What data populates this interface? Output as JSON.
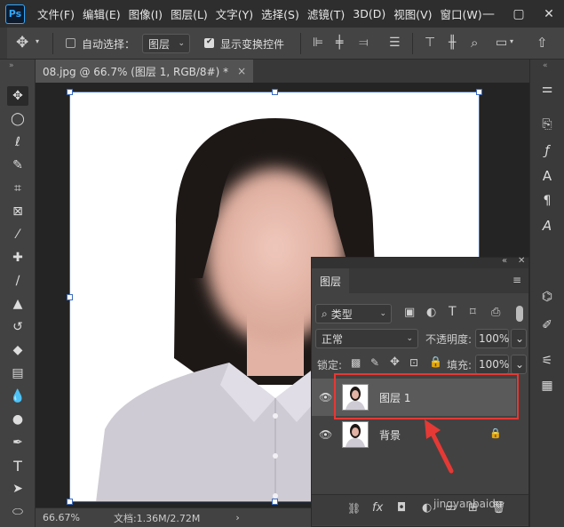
{
  "app": {
    "logo": "Ps"
  },
  "menu": [
    "文件(F)",
    "编辑(E)",
    "图像(I)",
    "图层(L)",
    "文字(Y)",
    "选择(S)",
    "滤镜(T)",
    "3D(D)",
    "视图(V)",
    "窗口(W)"
  ],
  "window_controls": [
    "—",
    "▢",
    "✕"
  ],
  "options": {
    "auto_select_label": "自动选择：",
    "auto_select_target": "图层",
    "show_transform_label": "显示变换控件"
  },
  "document_tab": {
    "title": "08.jpg @ 66.7% (图层 1, RGB/8#) *",
    "close": "×"
  },
  "status": {
    "zoom": "66.67%",
    "doc_info": "文档:1.36M/2.72M",
    "arrow": "›"
  },
  "layers_panel": {
    "tab": "图层",
    "filter_kind": "类型",
    "blend_mode": "正常",
    "opacity_label": "不透明度:",
    "opacity_value": "100%",
    "lock_label": "锁定:",
    "fill_label": "填充:",
    "fill_value": "100%",
    "layers": [
      {
        "name": "图层 1",
        "selected": true,
        "locked": false
      },
      {
        "name": "背景",
        "selected": false,
        "locked": true
      }
    ],
    "footer_fx": "fx"
  },
  "watermark": "jingyanbaidu",
  "colors": {
    "highlight": "#e53935",
    "selection_handle": "#3b6bbf",
    "arrow": "#e53935"
  }
}
